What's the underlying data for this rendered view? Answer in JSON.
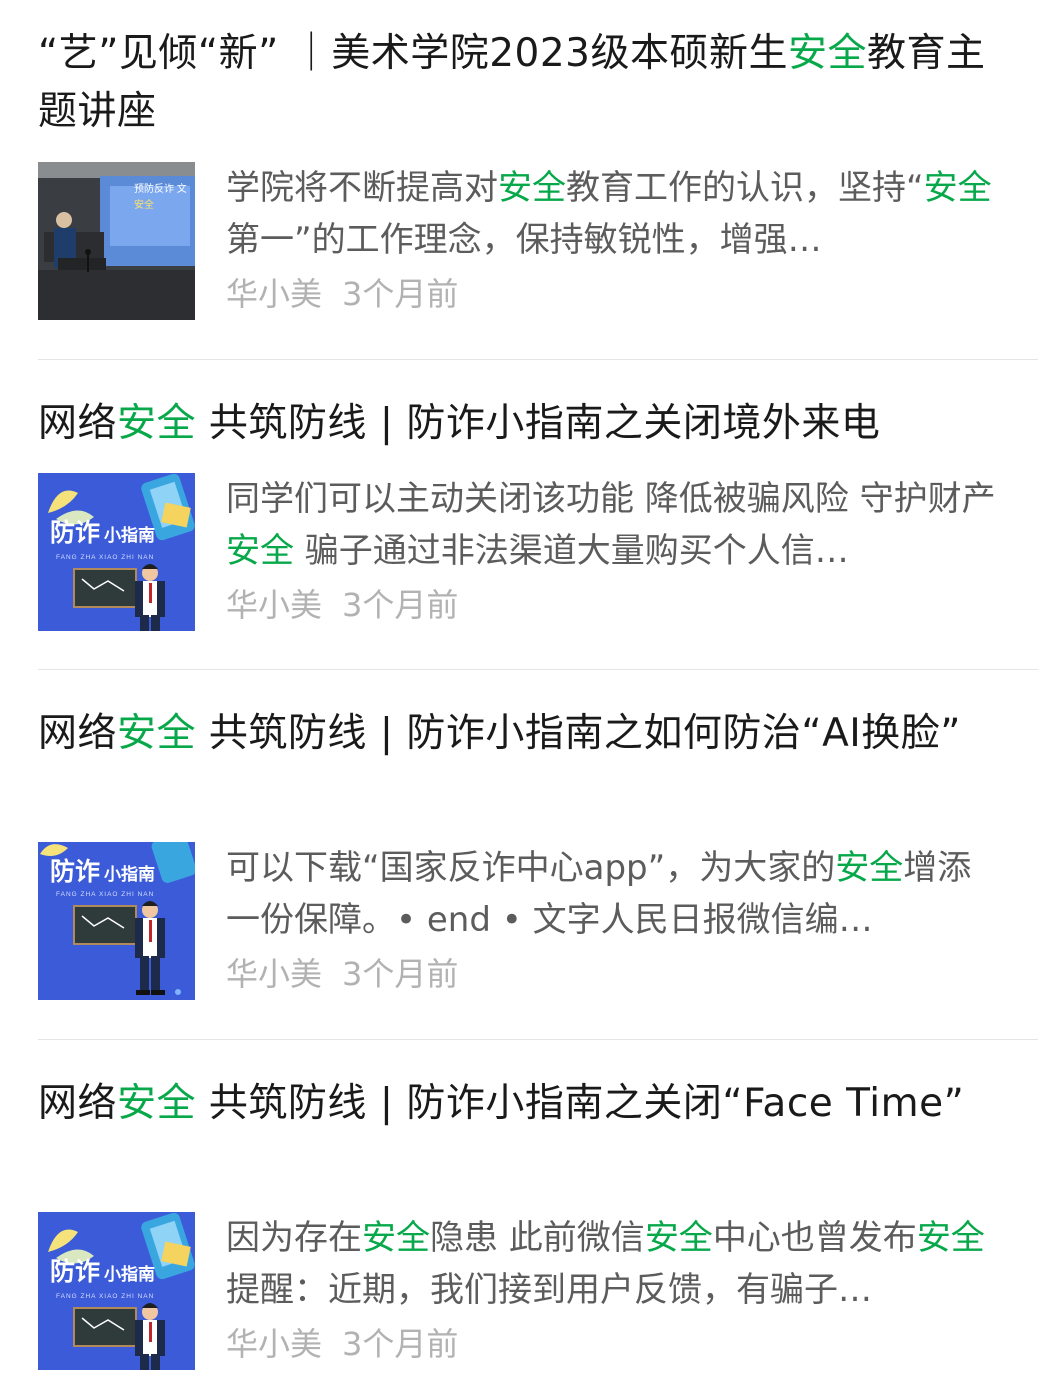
{
  "colors": {
    "highlight": "#07a84a",
    "title_text": "#1a1a1a",
    "snippet_text": "#5c5c5c",
    "meta_text": "#b2b2b2",
    "divider": "#e5e5e5"
  },
  "articles": [
    {
      "title_parts": [
        {
          "text": "“艺”见倾“新” ｜美术学院2023级本硕新生",
          "hl": false
        },
        {
          "text": "安全",
          "hl": true
        },
        {
          "text": "教育主题讲座",
          "hl": false
        }
      ],
      "snippet_parts": [
        {
          "text": "学院将不断提高对",
          "hl": false
        },
        {
          "text": "安全",
          "hl": true
        },
        {
          "text": "教育工作的认识，坚持“",
          "hl": false
        },
        {
          "text": "安全",
          "hl": true
        },
        {
          "text": "第一”的工作理念，保持敏锐性，增强…",
          "hl": false
        }
      ],
      "author": "华小美",
      "time": "3个月前",
      "thumbnail": "lecture-photo",
      "thumb_text": {
        "line1": "预防反诈 文",
        "line2": "安全"
      }
    },
    {
      "title_parts": [
        {
          "text": "网络",
          "hl": false
        },
        {
          "text": "安全",
          "hl": true
        },
        {
          "text": " 共筑防线 | 防诈小指南之关闭境外来电",
          "hl": false
        }
      ],
      "snippet_parts": [
        {
          "text": "同学们可以主动关闭该功能 降低被骗风险 守护财产",
          "hl": false
        },
        {
          "text": "安全",
          "hl": true
        },
        {
          "text": " 骗子通过非法渠道大量购买个人信…",
          "hl": false
        }
      ],
      "author": "华小美",
      "time": "3个月前",
      "thumbnail": "anti-fraud-guide",
      "thumb_text": {
        "big": "防诈",
        "small": "小指南",
        "pinyin": "FANG ZHA XIAO ZHI NAN"
      }
    },
    {
      "title_parts": [
        {
          "text": "网络",
          "hl": false
        },
        {
          "text": "安全",
          "hl": true
        },
        {
          "text": " 共筑防线 | 防诈小指南之如何防治“AI换脸”",
          "hl": false
        }
      ],
      "snippet_parts": [
        {
          "text": "可以下载“国家反诈中心app”，为大家的",
          "hl": false
        },
        {
          "text": "安全",
          "hl": true
        },
        {
          "text": "增添一份保障。• end • 文字人民日报微信编…",
          "hl": false
        }
      ],
      "author": "华小美",
      "time": "3个月前",
      "thumbnail": "anti-fraud-guide",
      "thumb_text": {
        "big": "防诈",
        "small": "小指南",
        "pinyin": "FANG ZHA XIAO ZHI NAN"
      }
    },
    {
      "title_parts": [
        {
          "text": "网络",
          "hl": false
        },
        {
          "text": "安全",
          "hl": true
        },
        {
          "text": " 共筑防线 | 防诈小指南之关闭“Face Time”",
          "hl": false
        }
      ],
      "snippet_parts": [
        {
          "text": "因为存在",
          "hl": false
        },
        {
          "text": "安全",
          "hl": true
        },
        {
          "text": "隐患 此前微信",
          "hl": false
        },
        {
          "text": "安全",
          "hl": true
        },
        {
          "text": "中心也曾发布",
          "hl": false
        },
        {
          "text": "安全",
          "hl": true
        },
        {
          "text": "提醒：近期，我们接到用户反馈，有骗子…",
          "hl": false
        }
      ],
      "author": "华小美",
      "time": "3个月前",
      "thumbnail": "anti-fraud-guide",
      "thumb_text": {
        "big": "防诈",
        "small": "小指南",
        "pinyin": "FANG ZHA XIAO ZHI NAN"
      }
    }
  ]
}
